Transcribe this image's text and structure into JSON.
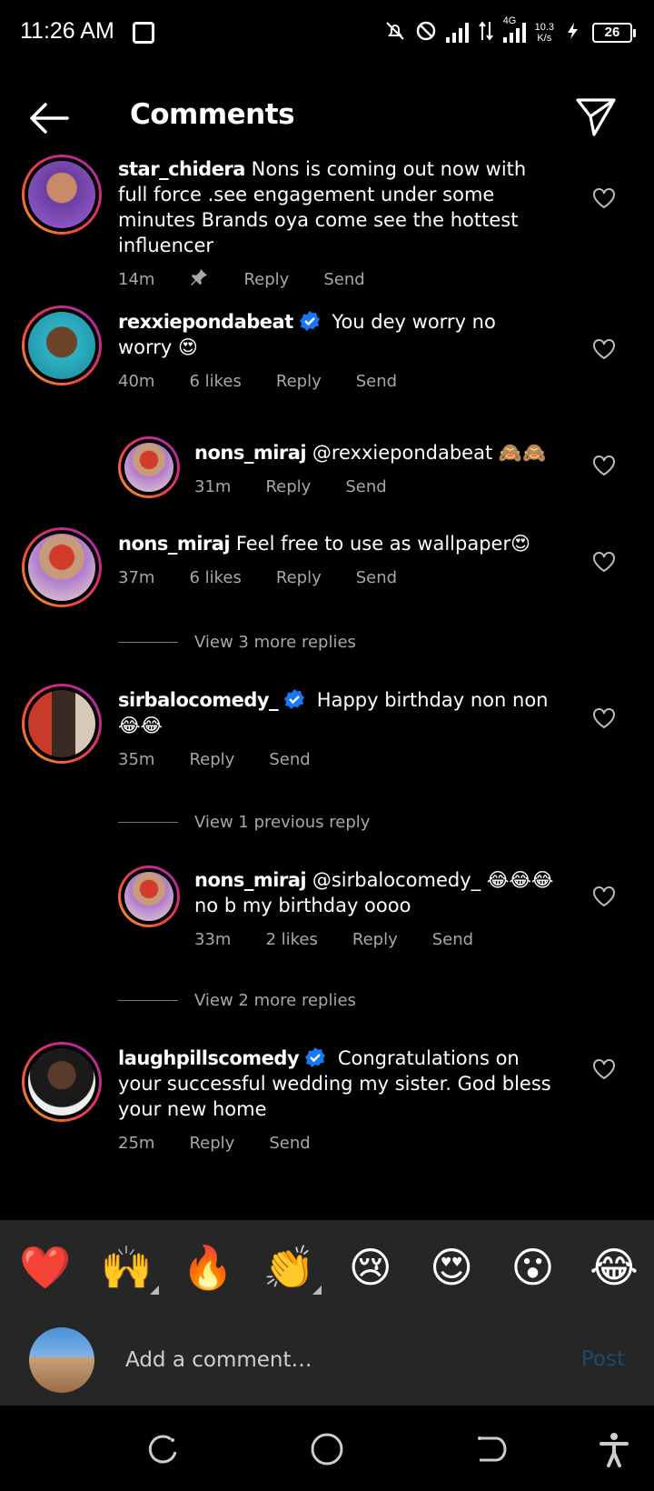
{
  "status_bar": {
    "time": "11:26 AM",
    "network": "4G",
    "speed_value": "10.3",
    "speed_unit": "K/s",
    "battery": "26"
  },
  "header": {
    "title": "Comments"
  },
  "comments": [
    {
      "username": "star_chidera",
      "verified": false,
      "text": "Nons is coming out now with full force .see engagement under some minutes Brands oya come see the hottest influencer",
      "time": "14m",
      "likes": "",
      "pinned": true,
      "reply_label": "Reply",
      "send_label": "Send"
    },
    {
      "username": "rexxiepondabeat",
      "verified": true,
      "text": "You dey worry no worry 😍",
      "time": "40m",
      "likes": "6 likes",
      "reply_label": "Reply",
      "send_label": "Send"
    },
    {
      "username": "nons_miraj",
      "verified": false,
      "text": "@rexxiepondabeat 🙈🙈",
      "time": "31m",
      "likes": "",
      "reply_label": "Reply",
      "send_label": "Send"
    },
    {
      "username": "nons_miraj",
      "verified": false,
      "text": "Feel free to use as wallpaper😍",
      "time": "37m",
      "likes": "6 likes",
      "reply_label": "Reply",
      "send_label": "Send"
    },
    {
      "username": "sirbalocomedy_",
      "verified": true,
      "text": "Happy birthday non non 😂😂",
      "time": "35m",
      "likes": "",
      "reply_label": "Reply",
      "send_label": "Send"
    },
    {
      "username": "nons_miraj",
      "verified": false,
      "text": "@sirbalocomedy_ 😂😂😂 no b my birthday oooo",
      "time": "33m",
      "likes": "2 likes",
      "reply_label": "Reply",
      "send_label": "Send"
    },
    {
      "username": "laughpillscomedy",
      "verified": true,
      "text": "Congratulations on your successful wedding my sister. God bless your new home",
      "time": "25m",
      "likes": "",
      "reply_label": "Reply",
      "send_label": "Send"
    }
  ],
  "view_more": [
    "View 3 more replies",
    "View 1 previous reply",
    "View 2 more replies"
  ],
  "emoji_bar": [
    "❤️",
    "🙌",
    "🔥",
    "👏",
    "😢",
    "😍",
    "😮",
    "😂"
  ],
  "comment_box": {
    "placeholder": "Add a comment…",
    "post_label": "Post"
  },
  "colors": {
    "background": "#000000",
    "muted_text": "#a8a8a8",
    "verified_badge": "#1877f2",
    "post_disabled": "#1b4a6e",
    "bar_background": "#262626"
  },
  "icons": [
    "back-arrow-icon",
    "send-direct-icon",
    "heart-icon",
    "pin-icon",
    "verified-badge-icon",
    "recents-icon",
    "home-icon",
    "back-nav-icon",
    "accessibility-icon"
  ]
}
